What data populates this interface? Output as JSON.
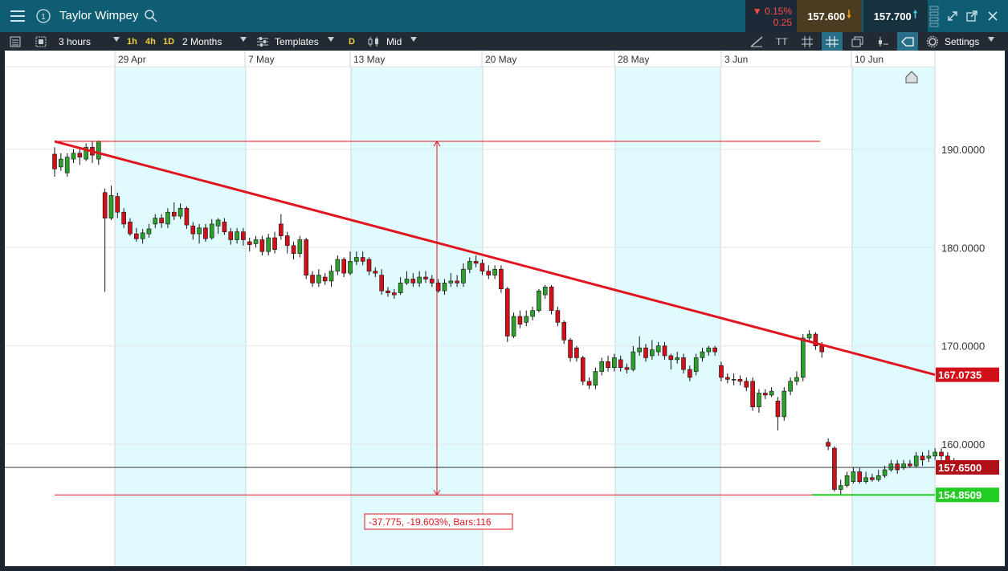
{
  "header": {
    "title": "Taylor Wimpey",
    "change_pct": "0.15%",
    "change_abs": "0.25",
    "bid": "157.600",
    "ask": "157.700"
  },
  "toolbar": {
    "interval": "3 hours",
    "tf_1h": "1h",
    "tf_4h": "4h",
    "tf_1d": "1D",
    "range": "2 Months",
    "templates": "Templates",
    "d_badge": "D",
    "price_type": "Mid",
    "text_tool": "TT",
    "settings": "Settings"
  },
  "colors": {
    "up": "#2e9e2e",
    "down": "#d2101a",
    "weekend_band": "#dffbfd",
    "trendline": "#e0151f",
    "support": "#22cc22"
  },
  "chart_data": {
    "type": "candlestick",
    "x_tick_labels": [
      "29 Apr",
      "7 May",
      "13 May",
      "20 May",
      "28 May",
      "3 Jun",
      "10 Jun"
    ],
    "y_tick_labels": [
      "190.0000",
      "180.0000",
      "170.0000",
      "160.0000"
    ],
    "y_ticks": [
      190,
      180,
      170,
      160
    ],
    "ylim": [
      147.6,
      198.4
    ],
    "grid": true,
    "current_price": 157.65,
    "current_price_label": "157.6500",
    "trendline_label": "167.0735",
    "trendline": {
      "from": [
        0,
        190.8
      ],
      "to": [
        136,
        167.07
      ]
    },
    "support_label": "154.8509",
    "support_level": 154.85,
    "measure": {
      "high": 190.8,
      "low": 154.85,
      "label": "-37.775, -19.603%, Bars:116"
    },
    "candles": [
      [
        189.5,
        188.0,
        190.2,
        187.2
      ],
      [
        188.2,
        189.0,
        189.6,
        187.8
      ],
      [
        187.6,
        189.2,
        189.6,
        187.2
      ],
      [
        189.0,
        189.6,
        190.0,
        188.6
      ],
      [
        189.6,
        189.2,
        190.0,
        188.4
      ],
      [
        189.0,
        190.2,
        190.6,
        188.8
      ],
      [
        190.2,
        189.4,
        190.8,
        188.6
      ],
      [
        189.0,
        190.8,
        190.9,
        188.4
      ],
      [
        185.6,
        183.0,
        186.0,
        175.5
      ],
      [
        183.0,
        185.3,
        186.3,
        182.8
      ],
      [
        185.2,
        183.6,
        185.6,
        183.0
      ],
      [
        183.6,
        182.4,
        184.0,
        182.0
      ],
      [
        182.6,
        181.4,
        183.0,
        181.2
      ],
      [
        181.4,
        180.9,
        182.0,
        180.6
      ],
      [
        180.9,
        181.5,
        181.9,
        180.4
      ],
      [
        181.4,
        181.9,
        182.4,
        181.0
      ],
      [
        182.4,
        183.0,
        183.4,
        182.0
      ],
      [
        183.0,
        182.5,
        183.4,
        182.0
      ],
      [
        182.4,
        183.6,
        184.0,
        182.0
      ],
      [
        183.6,
        183.2,
        184.6,
        182.8
      ],
      [
        183.2,
        184.0,
        184.5,
        182.9
      ],
      [
        184.0,
        182.3,
        184.2,
        181.9
      ],
      [
        182.2,
        181.4,
        182.6,
        180.8
      ],
      [
        181.4,
        182.0,
        182.4,
        180.4
      ],
      [
        182.0,
        180.9,
        182.4,
        180.6
      ],
      [
        181.0,
        182.4,
        182.9,
        180.8
      ],
      [
        182.2,
        182.8,
        183.0,
        181.4
      ],
      [
        182.6,
        181.6,
        183.0,
        181.3
      ],
      [
        181.6,
        180.8,
        182.0,
        180.3
      ],
      [
        180.8,
        181.6,
        182.0,
        180.4
      ],
      [
        181.6,
        180.8,
        182.0,
        180.2
      ],
      [
        180.6,
        180.3,
        181.0,
        179.6
      ],
      [
        180.4,
        180.8,
        181.2,
        180.0
      ],
      [
        180.8,
        179.6,
        181.2,
        179.2
      ],
      [
        179.6,
        181.0,
        181.4,
        179.2
      ],
      [
        181.0,
        179.8,
        181.6,
        179.4
      ],
      [
        182.4,
        181.2,
        183.4,
        180.8
      ],
      [
        181.2,
        180.2,
        181.6,
        179.4
      ],
      [
        180.2,
        179.4,
        180.6,
        178.8
      ],
      [
        179.4,
        180.8,
        181.2,
        179.0
      ],
      [
        180.8,
        177.2,
        181.0,
        176.8
      ],
      [
        177.2,
        176.4,
        177.6,
        176.0
      ],
      [
        176.4,
        177.2,
        177.8,
        176.0
      ],
      [
        177.0,
        176.6,
        177.4,
        176.2
      ],
      [
        176.6,
        177.6,
        178.2,
        176.0
      ],
      [
        177.6,
        178.8,
        179.2,
        177.2
      ],
      [
        178.8,
        177.4,
        179.0,
        177.0
      ],
      [
        177.4,
        178.6,
        179.6,
        177.2
      ],
      [
        178.6,
        179.0,
        179.6,
        178.2
      ],
      [
        179.0,
        178.6,
        179.6,
        178.2
      ],
      [
        178.8,
        177.6,
        179.0,
        177.2
      ],
      [
        177.6,
        177.4,
        178.0,
        177.0
      ],
      [
        177.2,
        175.6,
        177.8,
        175.2
      ],
      [
        175.6,
        175.4,
        176.0,
        175.0
      ],
      [
        175.4,
        175.2,
        175.8,
        174.8
      ],
      [
        175.4,
        176.4,
        177.0,
        175.2
      ],
      [
        176.4,
        176.8,
        177.6,
        176.2
      ],
      [
        176.8,
        176.4,
        177.4,
        176.0
      ],
      [
        176.4,
        177.0,
        177.6,
        176.0
      ],
      [
        177.0,
        176.8,
        177.6,
        176.4
      ],
      [
        176.8,
        176.4,
        177.2,
        176.0
      ],
      [
        176.4,
        175.6,
        176.8,
        175.4
      ],
      [
        175.6,
        176.4,
        176.8,
        175.2
      ],
      [
        176.4,
        176.6,
        177.4,
        176.0
      ],
      [
        176.6,
        176.4,
        177.2,
        176.0
      ],
      [
        176.4,
        177.8,
        178.4,
        176.0
      ],
      [
        177.8,
        178.6,
        179.0,
        177.4
      ],
      [
        178.6,
        178.4,
        179.2,
        178.0
      ],
      [
        178.4,
        177.6,
        178.8,
        177.2
      ],
      [
        177.6,
        177.2,
        178.2,
        176.8
      ],
      [
        177.2,
        177.8,
        178.2,
        176.8
      ],
      [
        177.8,
        175.8,
        178.2,
        175.4
      ],
      [
        175.8,
        171.0,
        176.0,
        170.4
      ],
      [
        171.0,
        173.0,
        173.4,
        170.8
      ],
      [
        173.0,
        172.2,
        173.6,
        171.8
      ],
      [
        172.4,
        173.0,
        173.6,
        172.0
      ],
      [
        173.0,
        173.6,
        174.0,
        172.6
      ],
      [
        173.6,
        175.6,
        175.8,
        173.4
      ],
      [
        175.2,
        176.0,
        176.2,
        174.8
      ],
      [
        176.0,
        173.6,
        176.2,
        173.2
      ],
      [
        173.6,
        172.4,
        174.0,
        172.0
      ],
      [
        172.4,
        170.6,
        172.6,
        170.2
      ],
      [
        170.6,
        168.8,
        170.8,
        168.4
      ],
      [
        169.8,
        168.8,
        170.0,
        168.4
      ],
      [
        168.8,
        166.4,
        169.0,
        166.0
      ],
      [
        166.4,
        166.0,
        166.8,
        165.6
      ],
      [
        166.0,
        167.4,
        167.8,
        165.6
      ],
      [
        167.4,
        168.4,
        168.8,
        167.0
      ],
      [
        168.4,
        167.8,
        169.0,
        167.4
      ],
      [
        167.8,
        168.8,
        169.2,
        167.4
      ],
      [
        168.6,
        167.8,
        169.0,
        167.4
      ],
      [
        167.8,
        167.6,
        168.2,
        167.2
      ],
      [
        167.6,
        169.4,
        170.0,
        167.4
      ],
      [
        169.4,
        169.8,
        171.0,
        169.0
      ],
      [
        169.8,
        168.8,
        170.2,
        168.4
      ],
      [
        169.0,
        169.6,
        170.6,
        168.6
      ],
      [
        169.4,
        170.0,
        170.4,
        169.0
      ],
      [
        170.0,
        169.0,
        170.4,
        168.6
      ],
      [
        169.0,
        168.6,
        169.2,
        167.6
      ],
      [
        168.6,
        168.8,
        169.4,
        168.2
      ],
      [
        168.8,
        167.6,
        169.2,
        167.2
      ],
      [
        167.6,
        166.8,
        168.0,
        166.4
      ],
      [
        167.4,
        168.8,
        169.2,
        167.0
      ],
      [
        168.8,
        169.4,
        169.8,
        168.4
      ],
      [
        169.4,
        169.8,
        170.0,
        169.0
      ],
      [
        169.8,
        169.4,
        170.0,
        169.0
      ],
      [
        168.0,
        166.8,
        168.4,
        166.4
      ],
      [
        166.8,
        166.6,
        167.2,
        166.2
      ],
      [
        166.6,
        166.6,
        167.2,
        166.0
      ],
      [
        166.6,
        166.4,
        167.0,
        166.0
      ],
      [
        166.4,
        165.8,
        166.8,
        165.4
      ],
      [
        166.4,
        163.8,
        166.8,
        163.4
      ],
      [
        163.8,
        165.2,
        165.6,
        163.2
      ],
      [
        165.2,
        165.0,
        165.6,
        164.6
      ],
      [
        165.0,
        165.4,
        165.8,
        164.8
      ],
      [
        164.4,
        162.8,
        164.8,
        161.4
      ],
      [
        162.8,
        165.4,
        165.8,
        162.4
      ],
      [
        165.4,
        166.4,
        166.8,
        165.0
      ],
      [
        166.4,
        166.8,
        167.4,
        166.0
      ],
      [
        166.8,
        170.8,
        171.2,
        166.4
      ],
      [
        170.8,
        171.2,
        171.6,
        170.4
      ],
      [
        171.2,
        170.0,
        171.4,
        169.6
      ],
      [
        170.0,
        169.4,
        170.4,
        168.8
      ],
      [
        160.2,
        159.8,
        160.6,
        159.4
      ],
      [
        159.6,
        155.4,
        159.8,
        155.2
      ],
      [
        155.4,
        155.8,
        156.4,
        154.9
      ],
      [
        155.8,
        156.8,
        157.2,
        155.6
      ],
      [
        156.2,
        157.2,
        157.6,
        156.0
      ],
      [
        157.2,
        156.2,
        157.6,
        156.0
      ],
      [
        156.2,
        156.6,
        157.2,
        156.0
      ],
      [
        156.6,
        156.4,
        157.0,
        156.2
      ],
      [
        156.4,
        156.8,
        157.4,
        156.2
      ],
      [
        156.8,
        157.4,
        157.8,
        156.6
      ],
      [
        157.4,
        158.0,
        158.4,
        157.2
      ],
      [
        158.0,
        157.4,
        158.4,
        157.0
      ],
      [
        157.6,
        158.0,
        158.4,
        157.4
      ],
      [
        158.0,
        157.8,
        158.4,
        157.6
      ],
      [
        157.8,
        158.8,
        159.2,
        157.6
      ],
      [
        158.8,
        158.4,
        159.2,
        157.8
      ],
      [
        158.6,
        158.8,
        159.4,
        158.2
      ],
      [
        158.8,
        159.2,
        159.6,
        158.4
      ],
      [
        159.2,
        158.8,
        159.6,
        158.4
      ],
      [
        158.8,
        157.6,
        159.2,
        157.4
      ],
      [
        157.4,
        158.2,
        158.6,
        157.2
      ]
    ]
  }
}
